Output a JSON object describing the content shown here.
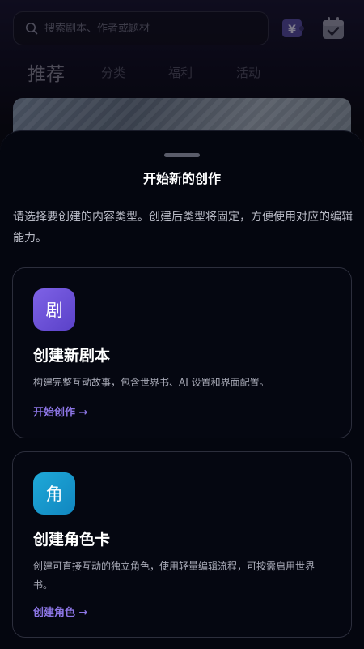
{
  "search": {
    "placeholder": "搜索剧本、作者或题材"
  },
  "tabs": [
    {
      "label": "推荐"
    },
    {
      "label": "分类"
    },
    {
      "label": "福利"
    },
    {
      "label": "活动"
    }
  ],
  "icons": {
    "search": "search-icon",
    "yen": "yen-icon",
    "calendar": "calendar-check-icon"
  },
  "sheet": {
    "title": "开始新的创作",
    "description": "请选择要创建的内容类型。创建后类型将固定，方便使用对应的编辑能力。",
    "cards": [
      {
        "icon_char": "剧",
        "title": "创建新剧本",
        "description": "构建完整互动故事，包含世界书、AI 设置和界面配置。",
        "link": "开始创作 →",
        "icon_color": "#6e52d8"
      },
      {
        "icon_char": "角",
        "title": "创建角色卡",
        "description": "创建可直接互动的独立角色，使用轻量编辑流程，可按需启用世界书。",
        "link": "创建角色 →",
        "icon_color": "#1a9dd0"
      }
    ]
  },
  "colors": {
    "accent": "#8d76e6",
    "background": "#04060f"
  }
}
